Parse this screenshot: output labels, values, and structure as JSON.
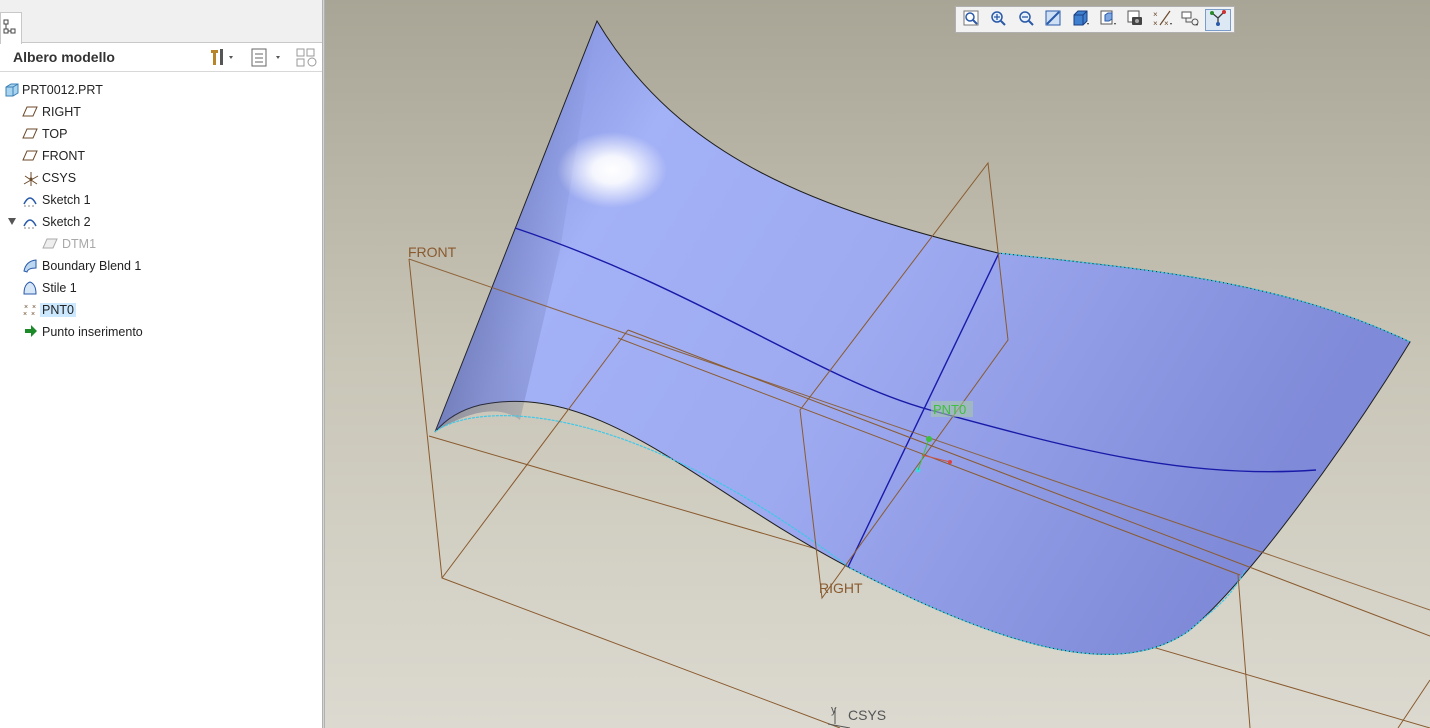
{
  "model_tree": {
    "title": "Albero modello",
    "items": [
      {
        "label": "PRT0012.PRT",
        "icon": "part-icon"
      },
      {
        "label": "RIGHT",
        "icon": "datum-plane-icon"
      },
      {
        "label": "TOP",
        "icon": "datum-plane-icon"
      },
      {
        "label": "FRONT",
        "icon": "datum-plane-icon"
      },
      {
        "label": "CSYS",
        "icon": "csys-icon"
      },
      {
        "label": "Sketch 1",
        "icon": "sketch-icon"
      },
      {
        "label": "Sketch 2",
        "icon": "sketch-icon",
        "expanded": true
      },
      {
        "label": "DTM1",
        "icon": "datum-plane-icon",
        "state": "suppressed"
      },
      {
        "label": "Boundary Blend 1",
        "icon": "boundary-blend-icon"
      },
      {
        "label": "Stile 1",
        "icon": "style-icon"
      },
      {
        "label": "PNT0",
        "icon": "datum-point-icon",
        "selected": true
      },
      {
        "label": "Punto inserimento",
        "icon": "insert-arrow-icon"
      }
    ]
  },
  "viewport": {
    "labels": {
      "front": "FRONT",
      "right": "RIGHT",
      "pnt0": "PNT0",
      "csys": "CSYS",
      "csys_axis": "y"
    },
    "colors": {
      "surface": "#9fadf4",
      "datum_plane": "#8a5a2e",
      "curve": "#1a1aa8",
      "point": "#3fbf3f"
    }
  },
  "view_toolbar": {
    "buttons": [
      {
        "name": "refit",
        "icon": "refit-icon"
      },
      {
        "name": "zoom-in",
        "icon": "zoom-in-icon"
      },
      {
        "name": "zoom-out",
        "icon": "zoom-out-icon"
      },
      {
        "name": "repaint",
        "icon": "repaint-icon"
      },
      {
        "name": "display-style",
        "icon": "display-style-icon"
      },
      {
        "name": "saved-views",
        "icon": "saved-views-icon"
      },
      {
        "name": "view-manager",
        "icon": "view-manager-icon"
      },
      {
        "name": "datum-display",
        "icon": "datum-display-icon"
      },
      {
        "name": "annotation-display",
        "icon": "annotation-display-icon"
      },
      {
        "name": "spin-center",
        "icon": "spin-center-icon",
        "active": true
      }
    ]
  }
}
